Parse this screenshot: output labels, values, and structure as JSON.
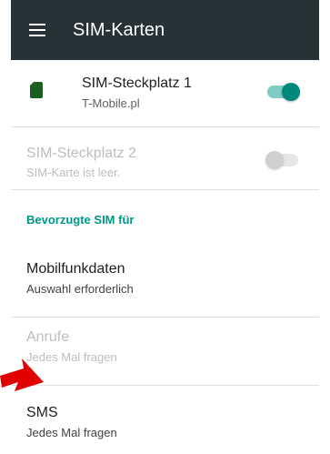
{
  "app_bar": {
    "title": "SIM-Karten",
    "menu_icon": "hamburger-menu-icon"
  },
  "sim_slots": [
    {
      "title": "SIM-Steckplatz 1",
      "subtitle": "T-Mobile.pl",
      "enabled": true,
      "toggle_on": true
    },
    {
      "title": "SIM-Steckplatz 2",
      "subtitle": "SIM-Karte ist leer.",
      "enabled": false,
      "toggle_on": false
    }
  ],
  "preferred_section": {
    "header": "Bevorzugte SIM für",
    "items": [
      {
        "title": "Mobilfunkdaten",
        "subtitle": "Auswahl erforderlich",
        "enabled": true
      },
      {
        "title": "Anrufe",
        "subtitle": "Jedes Mal fragen",
        "enabled": false
      },
      {
        "title": "SMS",
        "subtitle": "Jedes Mal fragen",
        "enabled": true
      }
    ]
  },
  "colors": {
    "app_bar": "#263238",
    "accent": "#009688",
    "toggle_on": "#00897b",
    "arrow": "#e00000"
  }
}
